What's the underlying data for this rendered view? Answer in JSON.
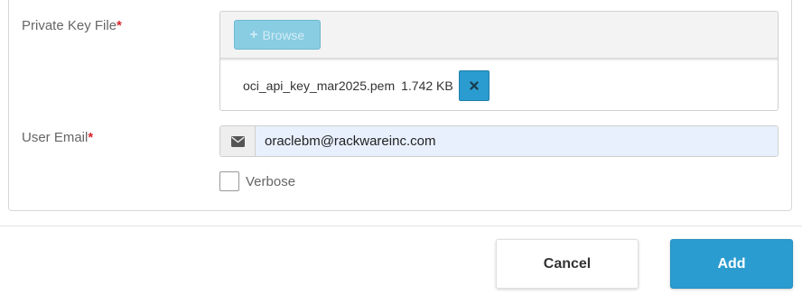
{
  "form": {
    "private_key": {
      "label": "Private Key File",
      "required_mark": "*",
      "browse_label": "Browse",
      "browse_icon": "plus-icon",
      "file_name": "oci_api_key_mar2025.pem",
      "file_size": "1.742 KB",
      "remove_icon": "close-icon"
    },
    "email": {
      "label": "User Email",
      "required_mark": "*",
      "icon": "envelope-icon",
      "value": "oraclebm@rackwareinc.com"
    },
    "verbose": {
      "label": "Verbose",
      "checked": false
    }
  },
  "footer": {
    "cancel_label": "Cancel",
    "add_label": "Add"
  },
  "colors": {
    "primary": "#2b9ccf",
    "browse_disabled": "#89cde3",
    "required": "#d9262d",
    "autofill_bg": "#e8f0fe"
  }
}
